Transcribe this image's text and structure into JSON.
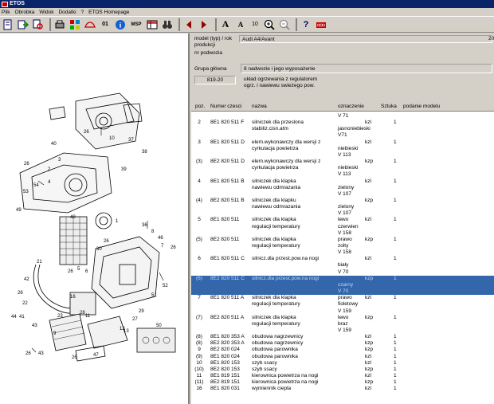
{
  "window": {
    "title": "ETOS"
  },
  "menu": [
    "Plik",
    "Obrobka",
    "Widok",
    "Dodatki",
    "?",
    "ETOS Homepage"
  ],
  "toolbar": {
    "buttons": [
      "page-icon",
      "export-icon",
      "search-icon",
      "print-icon",
      "grid-icon",
      "car-icon",
      "counter-icon",
      "info-icon",
      "msp-icon",
      "table-icon",
      "binoculars-icon",
      "arrow-left-icon",
      "arrow-right-icon",
      "font-larger-icon",
      "font-smaller-icon",
      "zoom-in-icon",
      "zoom-out-icon",
      "help-icon",
      "audi-icon"
    ],
    "counter_label": "01",
    "msp_label": "MSP",
    "font_size_value": "10",
    "font_a_large": "A",
    "font_a_small": "A",
    "help_label": "?"
  },
  "header": {
    "model_label": "model (typ) / rok produkcji",
    "model_value": "Audi A4/Avant",
    "year_value": "20",
    "chassis_label": "nr podwozia",
    "group_label": "Grupa główna",
    "group_value": "8   nadwozie i jego wyposażenie",
    "subgroup_code": "819-20",
    "subgroup_desc_1": "układ ogrzewania z regulatorem",
    "subgroup_desc_2": "ogrz. i nawiewu swieżego pow."
  },
  "parts_columns": [
    "poz.",
    "Numer czesci",
    "nazwa",
    "oznaczenie",
    "Sztuka",
    "podanie modelu"
  ],
  "parts_rows": [
    {
      "poz": "",
      "nr": "",
      "nazwa": "",
      "ozn": "V 71",
      "typ": "",
      "szt": ""
    },
    {
      "poz": "2",
      "nr": "8E1 820 511 F",
      "nazwa": "silniczek dla przeslona",
      "ozn": "",
      "typ": "kzl",
      "szt": "1"
    },
    {
      "poz": "",
      "nr": "",
      "nazwa": "stabiliz.cisn.atm",
      "ozn": "jasnoniebieski",
      "typ": "",
      "szt": ""
    },
    {
      "poz": "",
      "nr": "",
      "nazwa": "",
      "ozn": "V71",
      "typ": "",
      "szt": ""
    },
    {
      "poz": "3",
      "nr": "8E1 820 511 D",
      "nazwa": "elem.wykonawczy dla wersji z",
      "ozn": "",
      "typ": "kzl",
      "szt": "1"
    },
    {
      "poz": "",
      "nr": "",
      "nazwa": "cyrkulacja powietrza",
      "ozn": "niebieski",
      "typ": "",
      "szt": ""
    },
    {
      "poz": "",
      "nr": "",
      "nazwa": "",
      "ozn": "V 113",
      "typ": "",
      "szt": ""
    },
    {
      "poz": "(3)",
      "nr": "8E2 820 511 D",
      "nazwa": "elem.wykonawczy dla wersji z",
      "ozn": "",
      "typ": "kzp",
      "szt": "1"
    },
    {
      "poz": "",
      "nr": "",
      "nazwa": "cyrkulacja powietrza",
      "ozn": "niebieski",
      "typ": "",
      "szt": ""
    },
    {
      "poz": "",
      "nr": "",
      "nazwa": "",
      "ozn": "V 113",
      "typ": "",
      "szt": ""
    },
    {
      "poz": "4",
      "nr": "8E1 820 511 B",
      "nazwa": "silniczek dla klapka",
      "ozn": "",
      "typ": "kzl",
      "szt": "1"
    },
    {
      "poz": "",
      "nr": "",
      "nazwa": "nawiewu odmrazania",
      "ozn": "zielony",
      "typ": "",
      "szt": ""
    },
    {
      "poz": "",
      "nr": "",
      "nazwa": "",
      "ozn": "V 107",
      "typ": "",
      "szt": ""
    },
    {
      "poz": "(4)",
      "nr": "8E2 820 511 B",
      "nazwa": "silniczek dla klapku",
      "ozn": "",
      "typ": "kzp",
      "szt": "1"
    },
    {
      "poz": "",
      "nr": "",
      "nazwa": "nawiewu odmrazania",
      "ozn": "zielony",
      "typ": "",
      "szt": ""
    },
    {
      "poz": "",
      "nr": "",
      "nazwa": "",
      "ozn": "V 107",
      "typ": "",
      "szt": ""
    },
    {
      "poz": "5",
      "nr": "8E1 820 511",
      "nazwa": "silniczek dla klapka",
      "ozn": "lewo",
      "typ": "kzl",
      "szt": "1"
    },
    {
      "poz": "",
      "nr": "",
      "nazwa": "regulacji temperatury",
      "ozn": "czerwien",
      "typ": "",
      "szt": ""
    },
    {
      "poz": "",
      "nr": "",
      "nazwa": "",
      "ozn": "V 158",
      "typ": "",
      "szt": ""
    },
    {
      "poz": "(5)",
      "nr": "8E2 820 511",
      "nazwa": "silniczek dla klapka",
      "ozn": "prawo",
      "typ": "kzp",
      "szt": "1"
    },
    {
      "poz": "",
      "nr": "",
      "nazwa": "regulacji temperatury",
      "ozn": "zolty",
      "typ": "",
      "szt": ""
    },
    {
      "poz": "",
      "nr": "",
      "nazwa": "",
      "ozn": "V 158",
      "typ": "",
      "szt": ""
    },
    {
      "poz": "6",
      "nr": "8E1 820 511 C",
      "nazwa": "silnicz.dla przest.pow.na nogi",
      "ozn": "",
      "typ": "kzl",
      "szt": "1"
    },
    {
      "poz": "",
      "nr": "",
      "nazwa": "",
      "ozn": "biały",
      "typ": "",
      "szt": ""
    },
    {
      "poz": "",
      "nr": "",
      "nazwa": "",
      "ozn": "V 70",
      "typ": "",
      "szt": ""
    },
    {
      "poz": "(6)",
      "nr": "8E2 820 511 C",
      "nazwa": "silnicz.dla przest.pow.na nogi",
      "ozn": "",
      "typ": "kzp",
      "szt": "1",
      "sel": true
    },
    {
      "poz": "",
      "nr": "",
      "nazwa": "",
      "ozn": "czarny",
      "typ": "",
      "szt": "",
      "sel": true
    },
    {
      "poz": "",
      "nr": "",
      "nazwa": "",
      "ozn": "V 70",
      "typ": "",
      "szt": "",
      "sel": true
    },
    {
      "poz": "7",
      "nr": "8E1 820 511 A",
      "nazwa": "silniczek dla klapka",
      "ozn": "prawo",
      "typ": "kzl",
      "szt": "1"
    },
    {
      "poz": "",
      "nr": "",
      "nazwa": "regulacji temperatury",
      "ozn": "fioletowy",
      "typ": "",
      "szt": ""
    },
    {
      "poz": "",
      "nr": "",
      "nazwa": "",
      "ozn": "V 159",
      "typ": "",
      "szt": ""
    },
    {
      "poz": "(7)",
      "nr": "8E2 820 511 A",
      "nazwa": "silniczek dla klapka",
      "ozn": "lewo",
      "typ": "kzp",
      "szt": "1"
    },
    {
      "poz": "",
      "nr": "",
      "nazwa": "regulacji temperatury",
      "ozn": "braz",
      "typ": "",
      "szt": ""
    },
    {
      "poz": "",
      "nr": "",
      "nazwa": "",
      "ozn": "V 159",
      "typ": "",
      "szt": ""
    },
    {
      "poz": "(8)",
      "nr": "8E1 820 353 A",
      "nazwa": "obudowa nagrzewnicy",
      "ozn": "",
      "typ": "kzl",
      "szt": "1"
    },
    {
      "poz": "(8)",
      "nr": "8E2 820 353 A",
      "nazwa": "obudowa nagrzewnicy",
      "ozn": "",
      "typ": "kzp",
      "szt": "1"
    },
    {
      "poz": "9",
      "nr": "8E2 820 024",
      "nazwa": "obudowa parownika",
      "ozn": "",
      "typ": "kzp",
      "szt": "1"
    },
    {
      "poz": "(9)",
      "nr": "8E1 820 024",
      "nazwa": "obudowa parownika",
      "ozn": "",
      "typ": "kzl",
      "szt": "1"
    },
    {
      "poz": "10",
      "nr": "8E1 820 153",
      "nazwa": "szyb ssacy",
      "ozn": "",
      "typ": "kzl",
      "szt": "1"
    },
    {
      "poz": "(10)",
      "nr": "8E2 820 153",
      "nazwa": "szyb ssacy",
      "ozn": "",
      "typ": "kzp",
      "szt": "1"
    },
    {
      "poz": "11",
      "nr": "8E1 819 151",
      "nazwa": "kierownica powietrza na nogi",
      "ozn": "",
      "typ": "kzl",
      "szt": "1"
    },
    {
      "poz": "(11)",
      "nr": "8E2 819 151",
      "nazwa": "kierownica powietrza na nogi",
      "ozn": "",
      "typ": "kzp",
      "szt": "1"
    },
    {
      "poz": "16",
      "nr": "8E1 820 031",
      "nazwa": "wymiennik ciepla",
      "ozn": "",
      "typ": "kzl",
      "szt": "1"
    }
  ],
  "diagram_labels": [
    "26",
    "40",
    "10",
    "37",
    "38",
    "26",
    "3",
    "2",
    "39",
    "54",
    "53",
    "4",
    "49",
    "48",
    "1",
    "36",
    "46",
    "8",
    "7",
    "21",
    "30",
    "26",
    "22",
    "52",
    "42",
    "51",
    "16",
    "29",
    "44",
    "41",
    "23",
    "50",
    "43",
    "9",
    "11",
    "12",
    "26",
    "43",
    "26",
    "47",
    "13",
    "28",
    "5",
    "6",
    "26",
    "27",
    "24",
    "25"
  ],
  "colors": {
    "selection": "#3366aa",
    "titlebar": "#0a246a",
    "chrome": "#d4d0c8"
  }
}
